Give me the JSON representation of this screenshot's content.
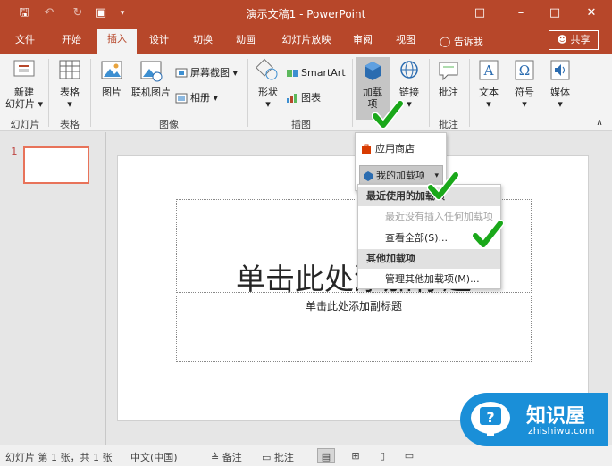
{
  "window": {
    "title": "演示文稿1  -  PowerPoint",
    "colors": {
      "accent": "#b7472a",
      "ribbon_bg": "#f3f3f3",
      "slide_border": "#e8735a",
      "check": "#1aa81a"
    }
  },
  "tabs": [
    "文件",
    "开始",
    "插入",
    "设计",
    "切换",
    "动画",
    "幻灯片放映",
    "审阅",
    "视图"
  ],
  "active_tab": "插入",
  "tell_me": "告诉我",
  "share": "共享",
  "ribbon": {
    "new_slide": "新建\n幻灯片",
    "table": "表格",
    "picture": "图片",
    "online_pictures": "联机图片",
    "screenshot": "屏幕截图",
    "album": "相册",
    "shapes": "形状",
    "smartart": "SmartArt",
    "chart": "图表",
    "addins": "加载\n项",
    "links": "链接",
    "comment": "批注",
    "text": "文本",
    "symbols": "符号",
    "media": "媒体",
    "groups": {
      "slides": "幻灯片",
      "tables": "表格",
      "images": "图像",
      "illustrations": "插图",
      "comments": "批注"
    }
  },
  "addins_menu": {
    "store": "应用商店",
    "my_addins": "我的加载项"
  },
  "my_addins_submenu": {
    "recent_header": "最近使用的加载项",
    "no_recent": "最近没有插入任何加载项",
    "see_all": "查看全部(S)...",
    "other_header": "其他加载项",
    "manage": "管理其他加载项(M)..."
  },
  "thumbnail": {
    "number": "1"
  },
  "slide": {
    "title_placeholder": "单击此处添加标题",
    "subtitle_placeholder": "单击此处添加副标题"
  },
  "statusbar": {
    "slide_info": "幻灯片 第 1 张，共 1 张",
    "language": "中文(中国)",
    "notes": "备注",
    "comments": "批注"
  },
  "watermark": {
    "title": "知识屋",
    "subtitle": "zhishiwu.com"
  }
}
